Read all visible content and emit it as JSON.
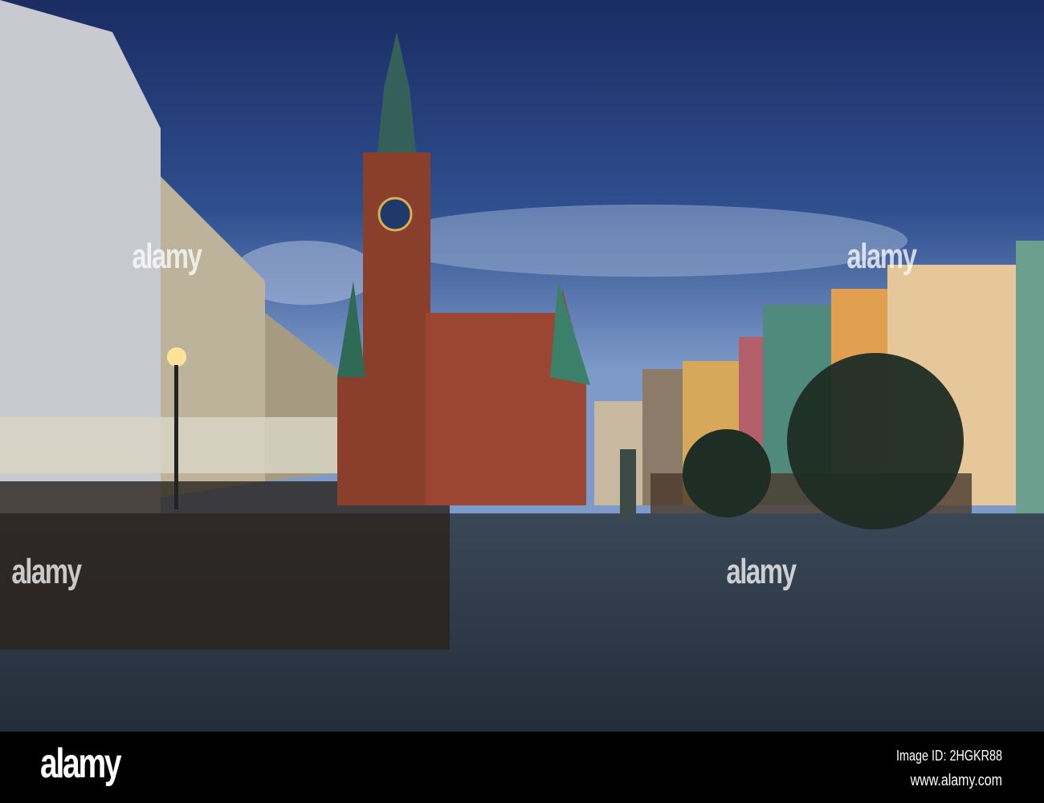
{
  "photo": {
    "subject": "Wroclaw Old Town Hall and Market Square at dusk"
  },
  "watermark": {
    "text": "alamy"
  },
  "footer": {
    "logo": "alamy",
    "image_id": "Image ID: 2HGKR88",
    "website": "www.alamy.com"
  },
  "colors": {
    "sky_top": "#1e3268",
    "sky_bottom": "#6f8fbf",
    "brick": "#8a3e2c",
    "plaza": "#2c3a48"
  }
}
